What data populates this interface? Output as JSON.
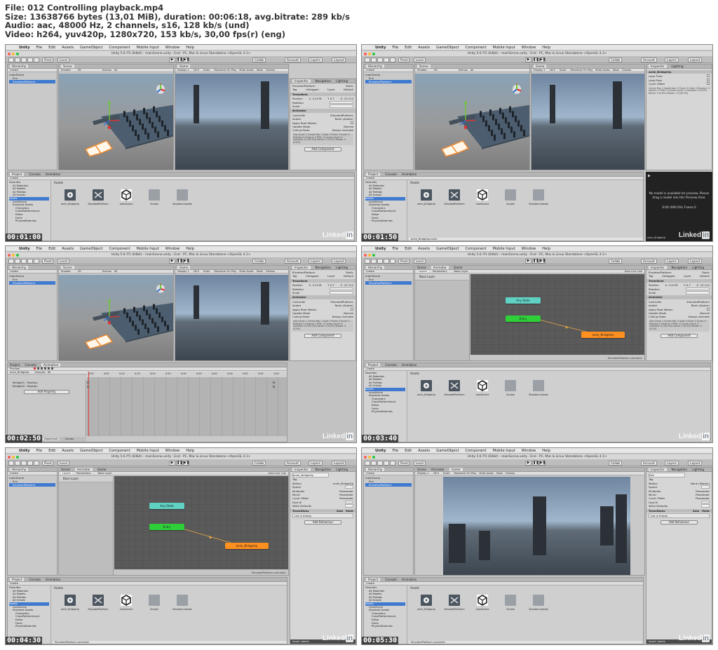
{
  "header": {
    "line1": "File: 012 Controlling playback.mp4",
    "line2": "Size: 13638766 bytes (13,01 MiB), duration: 00:06:18, avg.bitrate: 289 kb/s",
    "line3": "Audio: aac, 48000 Hz, 2 channels, s16, 128 kb/s (und)",
    "line4": "Video: h264, yuv420p, 1280x720, 153 kb/s, 30,00 fps(r) (eng)"
  },
  "menu": {
    "apple": "",
    "app": "Unity",
    "items": [
      "File",
      "Edit",
      "Assets",
      "GameObject",
      "Component",
      "Mobile Input",
      "Window",
      "Help"
    ]
  },
  "window_title": "Unity 5.6.?f1 (64bit) - mainScene.unity - End - PC, Mac & Linux Standalone <OpenGL 4.1>",
  "toolbar": {
    "pivot": "Pivot",
    "local": "Local",
    "collab": "Collab",
    "account": "Account",
    "layers": "Layers",
    "layout": "Layout"
  },
  "hierarchy": {
    "tab": "Hierarchy",
    "create": "Create",
    "scene": "mainScene",
    "children": [
      "Env",
      "ElevatedPlatform"
    ],
    "anim_children": [
      "Bridge01 : Position",
      "Bridge02 : Position"
    ]
  },
  "tabs": {
    "scene": "Scene",
    "game": "Game",
    "animator": "Animator",
    "animation": "Animation",
    "inspector": "Inspector",
    "navigation": "Navigation",
    "lighting": "Lighting",
    "project": "Project",
    "console": "Console",
    "layers": "Layers",
    "parameters": "Parameters",
    "base_layer": "Base Layer",
    "auto_live_link": "Auto Live Link"
  },
  "scene_bar": {
    "shaded": "Shaded",
    "twod": "2D",
    "gizmos": "Gizmos",
    "all": "All"
  },
  "game_bar": {
    "display": "Display 1",
    "aspect": "16:9",
    "scale": "Scale",
    "maximize": "Maximize On Play",
    "mute": "Mute Audio",
    "stats": "Stats",
    "gizmos": "Gizmos"
  },
  "inspector": {
    "object_name": "ElevatedPlatform",
    "static": "Static",
    "tag_label": "Tag",
    "tag_value": "Untagged",
    "layer_label": "Layer",
    "layer_value": "Default",
    "transform": "Transform",
    "position": "Position",
    "rotation": "Rotation",
    "scale": "Scale",
    "pos_x": "X -3.41?6",
    "pos_y": "Y 0.7",
    "pos_z": "Z -12.114",
    "animator": "Animator",
    "controller": "Controller",
    "controller_value": "ElevatedPlatform",
    "avatar": "Avatar",
    "avatar_value": "None (Avatar)",
    "apply_root": "Apply Root Motion",
    "update_mode": "Update Mode",
    "update_value": "Normal",
    "culling_mode": "Culling Mode",
    "culling_value": "Always Animate",
    "clip_info": "Clip Count: 1  Curves Pos: 2 Quat: 0 Euler: 0 Scale: 0 Muscles: 0 Generic: 0 PPtr: 0  Curves Count: 6 Constant: 6 (100.0%) Dense: 0 (0.0%) Stream: 0 (0.0%)",
    "add_component": "Add Component",
    "anim_bridge": "anim_BridgeUp",
    "loop_time": "Loop Time",
    "loop_pose": "Loop Pose",
    "cycle_offset": "Cycle Offset",
    "anim_clip_info": "Curves Pos: 1 Quaternion: 0 Euler: 0 Scale: 0 Muscles: 0 Generic: 0 PPtr: 0  Curves Count: 3 Constant: 0 (0.0%) Dense: 0 (0.0%) Stream: 3 (100.0%)",
    "preview_msg": "No model is available for preview. Please drag a model into this Preview Area.",
    "preview_time": "0:00 (000.0%) Frame 0",
    "motion": "Motion",
    "motion_value": "anim_BridgeUp",
    "motion_none": "None (Motion)",
    "speed": "Speed",
    "multiplier": "Multiplier",
    "parameter": "Parameter",
    "mirror": "Mirror",
    "cycle": "Cycle Offset",
    "foot_ik": "Foot IK",
    "write_defaults": "Write Defaults",
    "transitions": "Transitions",
    "solo": "Solo",
    "mute": "Mute",
    "list_empty": "List is Empty",
    "add_behaviour": "Add Behaviour",
    "state_idle": "Idle",
    "asset_labels": "Asset Labels"
  },
  "project": {
    "create": "Create",
    "favorites": "Favorites",
    "favorites_items": [
      "All Materials",
      "All Models",
      "All Prefabs",
      "All Scripts"
    ],
    "assets_root": "Assets",
    "assets_tree": [
      "mainScene",
      "Standard Assets",
      "Characters",
      "CrossPlatformInput",
      "Editor",
      "Fonts",
      "PhysicsMaterials"
    ],
    "assets_label": "Assets",
    "items": [
      "anim_BridgeUp",
      "ElevatedPlatform",
      "mainScene",
      "Scripts",
      "Standard Assets"
    ],
    "footer_anim": "anim_BridgeUp.anim",
    "footer_ctrl": "ElevatedPlatform.controller"
  },
  "animation_panel": {
    "preview": "Preview",
    "clip": "anim_BridgeUp",
    "samples": "Samples",
    "samples_value": "60",
    "add_property": "Add Property",
    "dopesheet": "Dopesheet",
    "curves": "Curves",
    "ticks": [
      "0:00",
      "0:05",
      "0:10",
      "0:15",
      "0:20",
      "0:25",
      "0:30",
      "0:35",
      "0:40",
      "0:45",
      "0:50",
      "0:55",
      "1:00"
    ]
  },
  "states": {
    "any": "Any State",
    "entry": "Entry",
    "clip": "anim_BridgeUp",
    "controller_footer": "ElevatedPlatform.controller"
  },
  "timestamps": [
    "00:01:00",
    "00:01:50",
    "00:02:50",
    "00:03:40",
    "00:04:30",
    "00:05:30"
  ],
  "watermark": {
    "text": "Linked",
    "box": "in"
  },
  "colors": {
    "entry": "#2fcf3a",
    "any_state": "#5fd2c4",
    "clip_state": "#ff8f1f",
    "selection": "#3f7ad0",
    "traffic_red": "#fc5f57",
    "traffic_yellow": "#fdbc2e",
    "traffic_green": "#28c840"
  },
  "icons": [
    "apple-icon",
    "hand-tool-icon",
    "move-tool-icon",
    "rotate-tool-icon",
    "scale-tool-icon",
    "rect-tool-icon",
    "play-icon",
    "pause-icon",
    "step-icon",
    "animation-clip-icon",
    "animator-controller-icon",
    "unity-scene-icon",
    "folder-icon"
  ]
}
